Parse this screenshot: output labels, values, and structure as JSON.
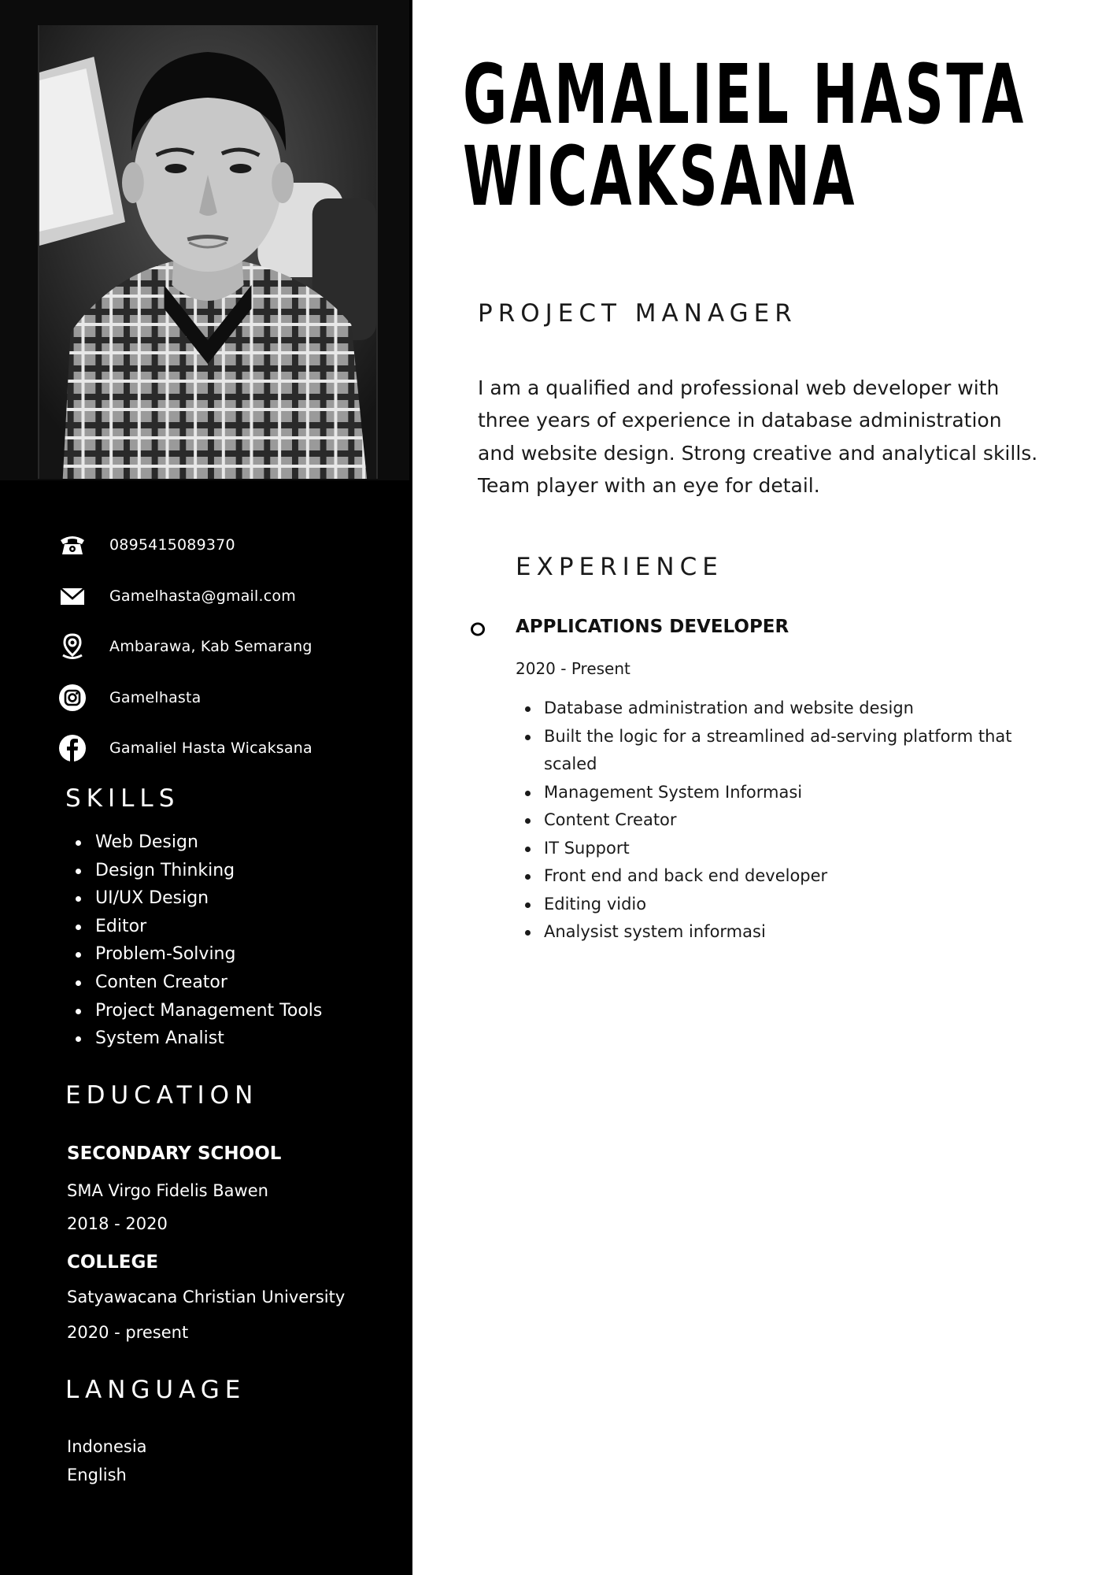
{
  "name": {
    "line1": "GAMALIEL HASTA",
    "line2": "WICAKSANA"
  },
  "job_title": "PROJECT MANAGER",
  "summary": "I am a qualified and professional web developer with three years of experience in database administration and website design. Strong creative and analytical skills. Team player with an eye for detail.",
  "contacts": {
    "phone": {
      "icon": "phone-icon",
      "text": "0895415089370"
    },
    "email": {
      "icon": "mail-icon",
      "text": "Gamelhasta@gmail.com"
    },
    "location": {
      "icon": "location-pin-icon",
      "text": "Ambarawa, Kab Semarang"
    },
    "instagram": {
      "icon": "instagram-icon",
      "text": "Gamelhasta"
    },
    "facebook": {
      "icon": "facebook-icon",
      "text": "Gamaliel Hasta Wicaksana"
    }
  },
  "skills": {
    "heading": "SKILLS",
    "items": [
      "Web Design",
      "Design Thinking",
      "UI/UX Design",
      "Editor",
      "Problem-Solving",
      "Conten Creator",
      "Project Management Tools",
      "System Analist"
    ]
  },
  "education": {
    "heading": "EDUCATION",
    "entries": [
      {
        "level": "SECONDARY SCHOOL",
        "school": "SMA Virgo Fidelis Bawen",
        "years": "2018 - 2020"
      },
      {
        "level": "COLLEGE",
        "school": "Satyawacana Christian University",
        "years": "2020 - present"
      }
    ]
  },
  "language": {
    "heading": "LANGUAGE",
    "items": [
      "Indonesia",
      "English"
    ]
  },
  "experience": {
    "heading": "EXPERIENCE",
    "role": "APPLICATIONS DEVELOPER",
    "dates": "2020 - Present",
    "duties": [
      "Database administration and website design",
      "Built the logic for a streamlined ad-serving platform that scaled",
      "Management System Informasi",
      "Content Creator",
      "IT Support",
      "Front end and back end developer",
      "Editing vidio",
      "Analysist system informasi"
    ]
  },
  "colors": {
    "sidebar": "#000000",
    "text_dark": "#1a1a1a",
    "text_light": "#ffffff"
  }
}
